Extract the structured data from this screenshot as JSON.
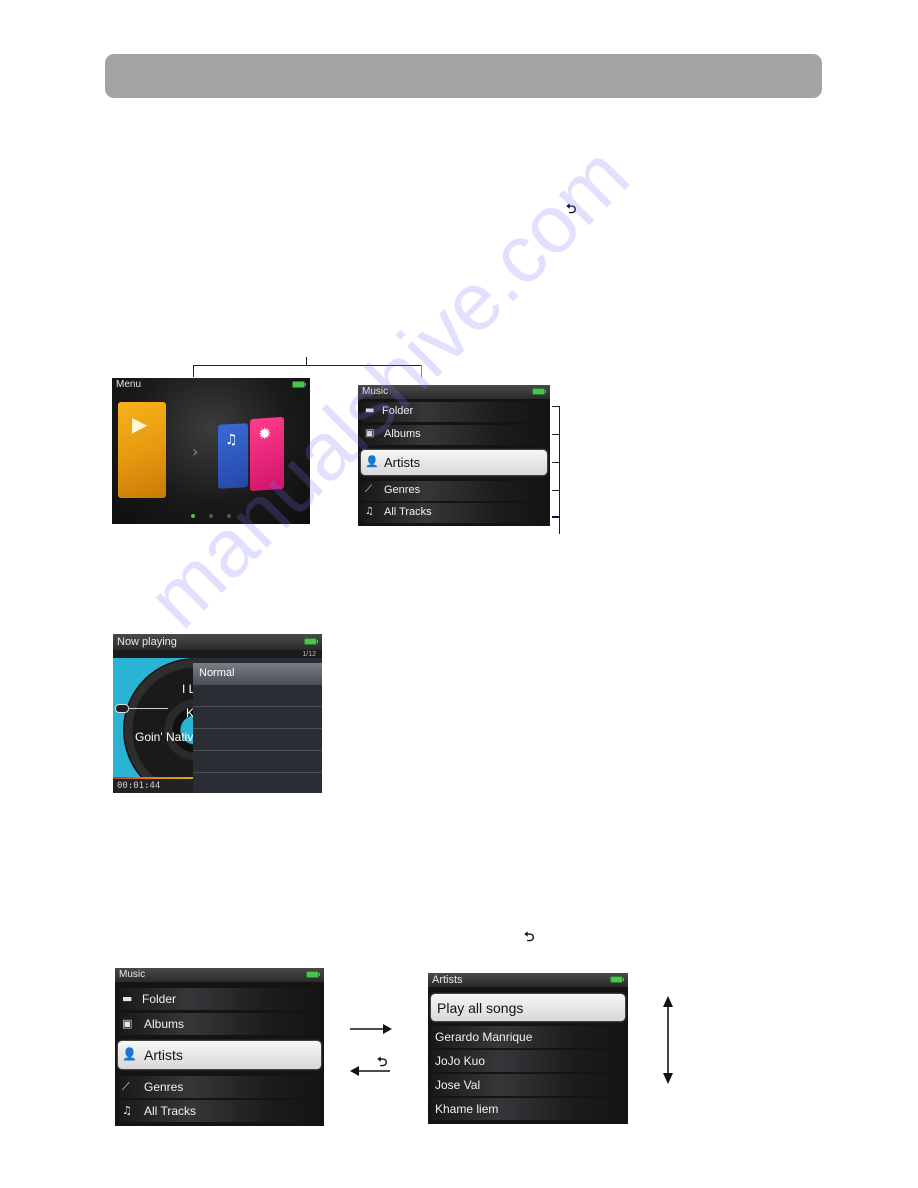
{
  "header": {
    "title": ""
  },
  "instruction_back_icon": "back-arrow-icon",
  "menu_screen": {
    "title": "Menu",
    "battery": "full",
    "cards": [
      {
        "name": "play",
        "icon": "play-icon",
        "color": "#f0a614"
      },
      {
        "name": "music",
        "icon": "music-note-icon",
        "color": "#2f5bc4"
      },
      {
        "name": "settings",
        "icon": "gear-icon",
        "color": "#e8217a"
      }
    ],
    "nav_arrow": "›",
    "page_dots": {
      "count": 3,
      "active": 1
    },
    "glyphs": {
      "play": "▶",
      "music": "♫",
      "settings": "✹"
    }
  },
  "music_screen_top": {
    "title": "Music",
    "items": [
      {
        "label": "Folder",
        "icon": "folder-icon",
        "glyph": "▬"
      },
      {
        "label": "Albums",
        "icon": "album-icon",
        "glyph": "▣"
      },
      {
        "label": "Artists",
        "icon": "artist-icon",
        "glyph": "👤",
        "selected": true
      },
      {
        "label": "Genres",
        "icon": "guitar-icon",
        "glyph": "⟋"
      },
      {
        "label": "All Tracks",
        "icon": "music-note-icon",
        "glyph": "♫"
      }
    ]
  },
  "now_playing": {
    "title": "Now playing",
    "track_counter": "1/12",
    "visible_text": [
      "I L",
      "K",
      "Goin' Nativ"
    ],
    "time": "00:01:44",
    "popup": {
      "items": [
        "Normal",
        "",
        "",
        "",
        "",
        ""
      ],
      "selected": 0
    }
  },
  "music_screen_bottom": {
    "title": "Music",
    "items": [
      {
        "label": "Folder",
        "glyph": "▬"
      },
      {
        "label": "Albums",
        "glyph": "▣"
      },
      {
        "label": "Artists",
        "glyph": "👤",
        "selected": true
      },
      {
        "label": "Genres",
        "glyph": "⟋"
      },
      {
        "label": "All Tracks",
        "glyph": "♫"
      }
    ]
  },
  "artists_screen": {
    "title": "Artists",
    "items": [
      {
        "label": "Play all songs",
        "selected": true
      },
      {
        "label": "Gerardo Manrique"
      },
      {
        "label": "JoJo Kuo"
      },
      {
        "label": "Jose Val"
      },
      {
        "label": "Khame liem"
      }
    ]
  },
  "arrows": {
    "forward": "→",
    "back": "←",
    "back_icon_glyph": "⮌",
    "scroll": "↕"
  },
  "watermark": "manualshive.com"
}
